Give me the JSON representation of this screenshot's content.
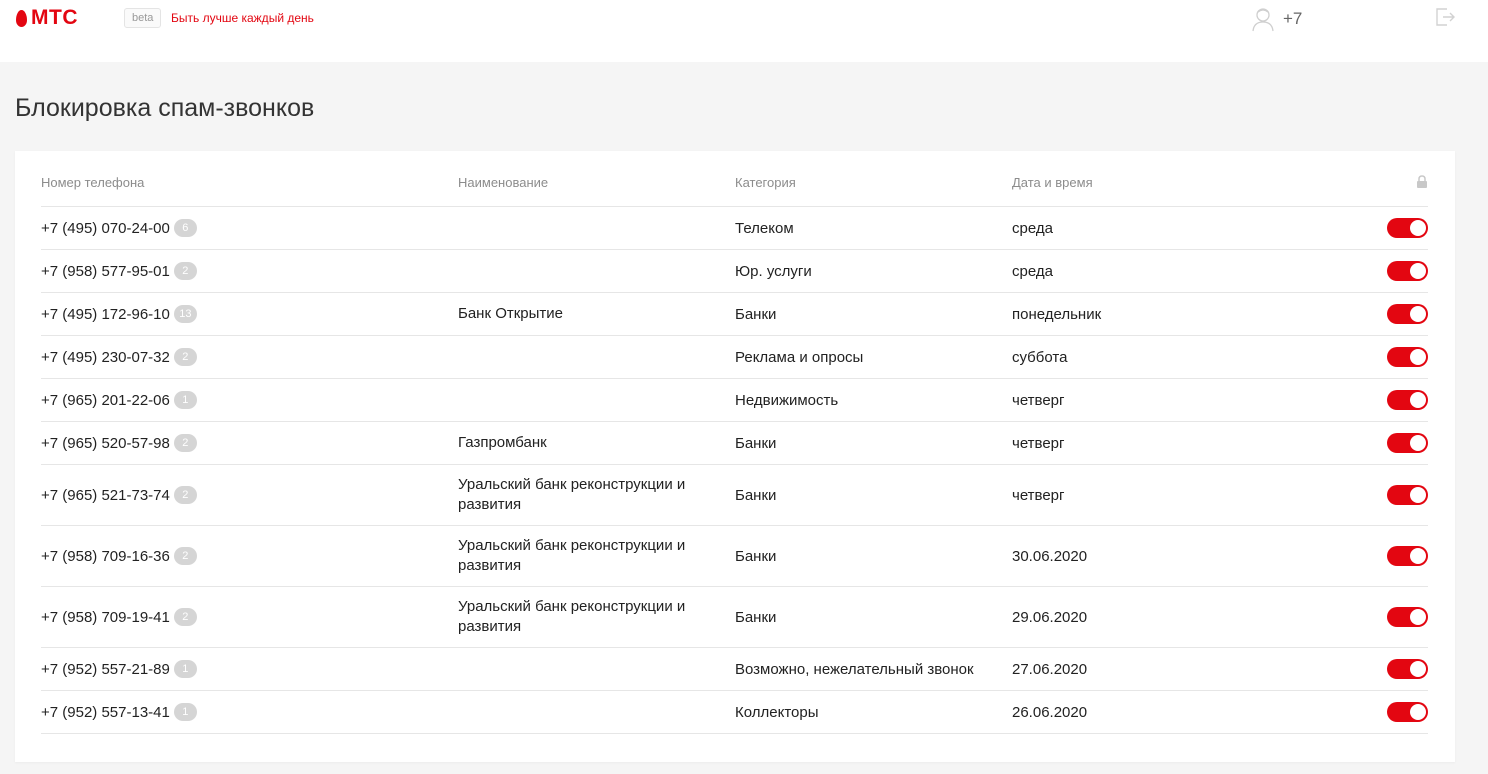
{
  "header": {
    "logo_text": "МТС",
    "beta_label": "beta",
    "tagline": "Быть лучше каждый день",
    "user_phone": "+7",
    "accent_color": "#e30611"
  },
  "page": {
    "title": "Блокировка спам-звонков"
  },
  "table": {
    "columns": [
      "Номер телефона",
      "Наименование",
      "Категория",
      "Дата и время"
    ],
    "rows": [
      {
        "phone": "+7 (495) 070-24-00",
        "count": "6",
        "name": "",
        "category": "Телеком",
        "date": "среда",
        "blocked": true
      },
      {
        "phone": "+7 (958) 577-95-01",
        "count": "2",
        "name": "",
        "category": "Юр. услуги",
        "date": "среда",
        "blocked": true
      },
      {
        "phone": "+7 (495) 172-96-10",
        "count": "13",
        "name": "Банк Открытие",
        "category": "Банки",
        "date": "понедельник",
        "blocked": true
      },
      {
        "phone": "+7 (495) 230-07-32",
        "count": "2",
        "name": "",
        "category": "Реклама и опросы",
        "date": "суббота",
        "blocked": true
      },
      {
        "phone": "+7 (965) 201-22-06",
        "count": "1",
        "name": "",
        "category": "Недвижимость",
        "date": "четверг",
        "blocked": true
      },
      {
        "phone": "+7 (965) 520-57-98",
        "count": "2",
        "name": "Газпромбанк",
        "category": "Банки",
        "date": "четверг",
        "blocked": true
      },
      {
        "phone": "+7 (965) 521-73-74",
        "count": "2",
        "name": "Уральский банк реконструкции и развития",
        "category": "Банки",
        "date": "четверг",
        "blocked": true
      },
      {
        "phone": "+7 (958) 709-16-36",
        "count": "2",
        "name": "Уральский банк реконструкции и развития",
        "category": "Банки",
        "date": "30.06.2020",
        "blocked": true
      },
      {
        "phone": "+7 (958) 709-19-41",
        "count": "2",
        "name": "Уральский банк реконструкции и развития",
        "category": "Банки",
        "date": "29.06.2020",
        "blocked": true
      },
      {
        "phone": "+7 (952) 557-21-89",
        "count": "1",
        "name": "",
        "category": "Возможно, нежелательный звонок",
        "date": "27.06.2020",
        "blocked": true
      },
      {
        "phone": "+7 (952) 557-13-41",
        "count": "1",
        "name": "",
        "category": "Коллекторы",
        "date": "26.06.2020",
        "blocked": true
      }
    ]
  },
  "icons": {
    "logo": "mts-egg-logo",
    "user": "user-avatar-icon",
    "logout": "logout-icon",
    "lock": "lock-icon"
  }
}
